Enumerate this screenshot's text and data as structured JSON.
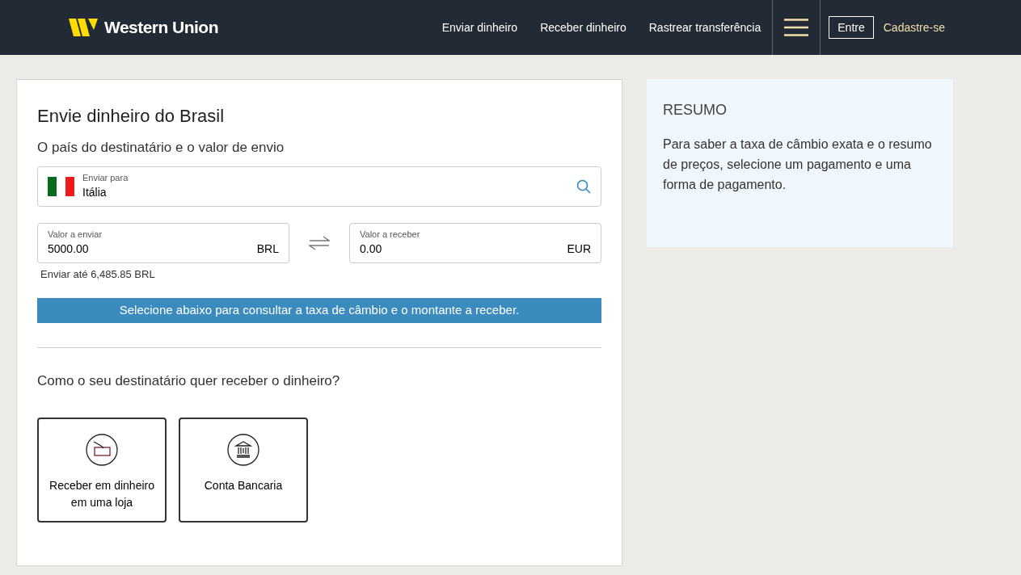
{
  "header": {
    "brand": "Western Union",
    "nav": [
      "Enviar dinheiro",
      "Receber dinheiro",
      "Rastrear transferência"
    ],
    "login": "Entre",
    "signup": "Cadastre-se"
  },
  "form": {
    "title": "Envie dinheiro do Brasil",
    "subtitle": "O país do destinatário e o valor de envio",
    "destination": {
      "label": "Enviar para",
      "value": "Itália"
    },
    "send": {
      "label": "Valor a enviar",
      "value": "5000.00",
      "currency": "BRL"
    },
    "receive": {
      "label": "Valor a receber",
      "value": "0.00",
      "currency": "EUR"
    },
    "limit": "Enviar até 6,485.85 BRL",
    "banner": "Selecione abaixo para consultar a taxa de câmbio e o montante a receber.",
    "question": "Como o seu destinatário quer receber o dinheiro?",
    "options": [
      {
        "kind": "cash",
        "label": "Receber em dinheiro em uma loja"
      },
      {
        "kind": "bank",
        "label": "Conta Bancaria"
      }
    ]
  },
  "summary": {
    "title": "RESUMO",
    "text": "Para saber a taxa de câmbio exata e o resumo de preços, selecione um pagamento e uma forma de pagamento."
  }
}
